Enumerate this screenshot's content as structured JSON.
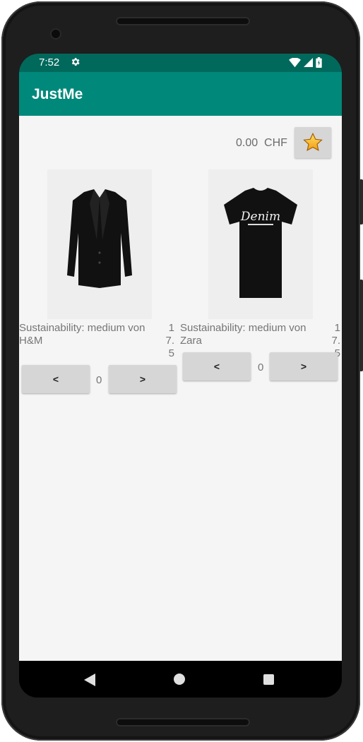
{
  "status_bar": {
    "time": "7:52",
    "icons": [
      "gear-icon",
      "wifi-icon",
      "signal-icon",
      "battery-icon"
    ]
  },
  "app_bar": {
    "title": "JustMe",
    "color": "#00897b",
    "status_color": "#00695c"
  },
  "cart": {
    "total": "0.00",
    "currency": "CHF",
    "favorite_icon": "star-icon"
  },
  "products": [
    {
      "name": "Sustainability: medium von H&M",
      "price": "17.5",
      "quantity": "0",
      "decrement_label": "<",
      "increment_label": ">",
      "image": "black-blazer"
    },
    {
      "name": "Sustainability: medium von Zara",
      "price": "17.5",
      "quantity": "0",
      "decrement_label": "<",
      "increment_label": ">",
      "image": "black-denim-tshirt",
      "image_text": "Denim"
    }
  ],
  "nav_bar": {
    "icons": [
      "back-icon",
      "home-icon",
      "recents-icon"
    ]
  }
}
